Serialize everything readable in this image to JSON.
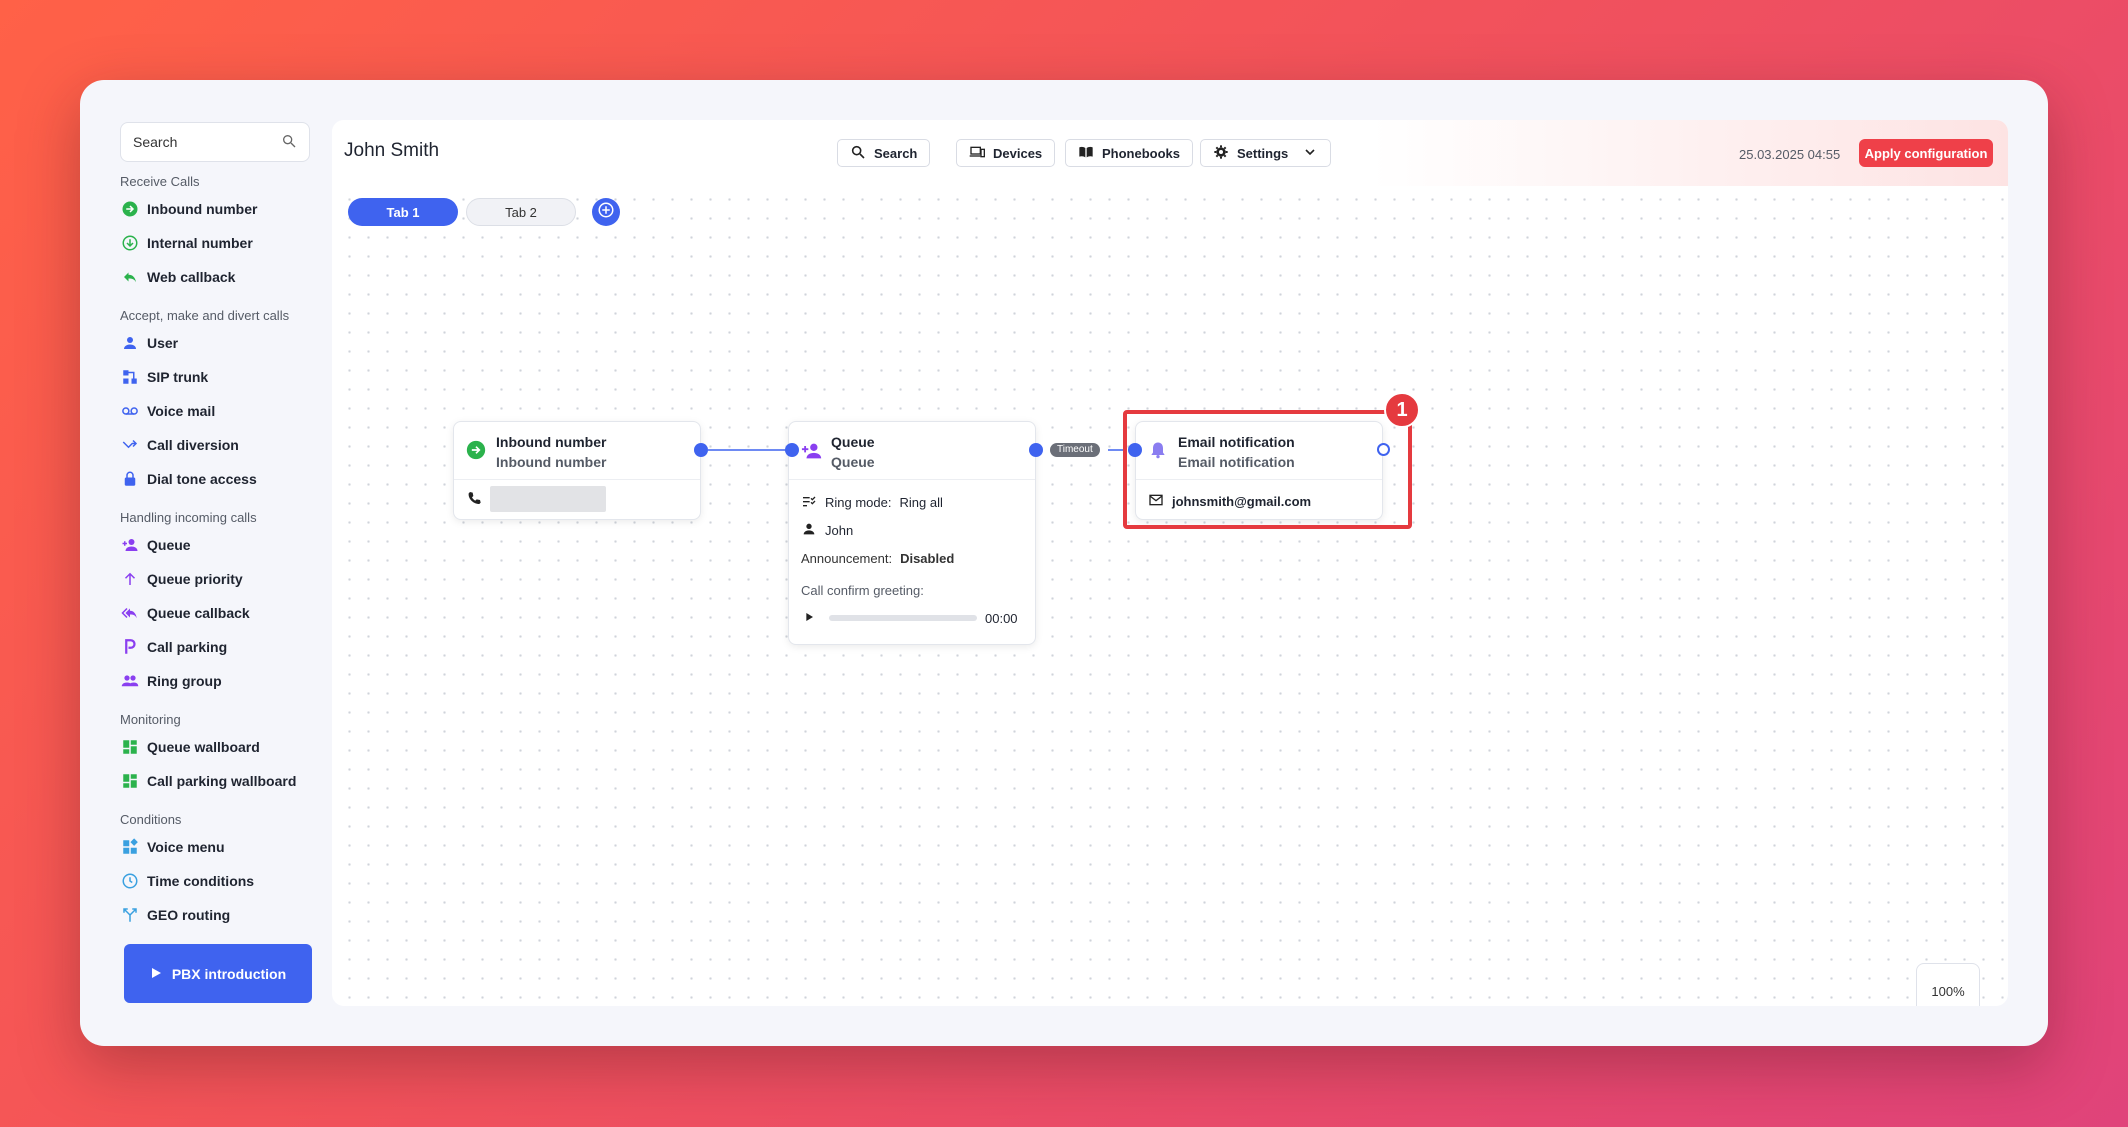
{
  "sidebar": {
    "search_placeholder": "Search",
    "groups": [
      {
        "title": "Receive Calls",
        "items": [
          {
            "label": "Inbound number",
            "icon": "arrow-circle-icon",
            "color": "#2bb24c"
          },
          {
            "label": "Internal number",
            "icon": "download-circle-icon",
            "color": "#2bb24c"
          },
          {
            "label": "Web callback",
            "icon": "reply-icon",
            "color": "#2bb24c"
          }
        ]
      },
      {
        "title": "Accept, make and divert calls",
        "items": [
          {
            "label": "User",
            "icon": "user-icon",
            "color": "#3f63ef"
          },
          {
            "label": "SIP trunk",
            "icon": "sip-trunk-icon",
            "color": "#3f63ef"
          },
          {
            "label": "Voice mail",
            "icon": "voicemail-icon",
            "color": "#3f63ef"
          },
          {
            "label": "Call diversion",
            "icon": "call-diversion-icon",
            "color": "#3f63ef"
          },
          {
            "label": "Dial tone access",
            "icon": "lock-icon",
            "color": "#3f63ef"
          }
        ]
      },
      {
        "title": "Handling incoming calls",
        "items": [
          {
            "label": "Queue",
            "icon": "person-add-icon",
            "color": "#8a3ff0"
          },
          {
            "label": "Queue priority",
            "icon": "arrow-up-icon",
            "color": "#8a3ff0"
          },
          {
            "label": "Queue callback",
            "icon": "reply-all-icon",
            "color": "#8a3ff0"
          },
          {
            "label": "Call parking",
            "icon": "parking-icon",
            "color": "#8a3ff0"
          },
          {
            "label": "Ring group",
            "icon": "group-icon",
            "color": "#8a3ff0"
          }
        ]
      },
      {
        "title": "Monitoring",
        "items": [
          {
            "label": "Queue wallboard",
            "icon": "dashboard-icon",
            "color": "#2bb24c"
          },
          {
            "label": "Call parking wallboard",
            "icon": "dashboard-icon",
            "color": "#2bb24c"
          }
        ]
      },
      {
        "title": "Conditions",
        "items": [
          {
            "label": "Voice menu",
            "icon": "widgets-icon",
            "color": "#3aa0e0"
          },
          {
            "label": "Time conditions",
            "icon": "clock-icon",
            "color": "#3aa0e0"
          },
          {
            "label": "GEO routing",
            "icon": "fork-icon",
            "color": "#3aa0e0"
          }
        ]
      }
    ],
    "pbx_button": "PBX introduction"
  },
  "header": {
    "title": "John Smith",
    "search_label": "Search",
    "devices_label": "Devices",
    "phonebooks_label": "Phonebooks",
    "settings_label": "Settings",
    "timestamp": "25.03.2025 04:55",
    "apply_label": "Apply configuration"
  },
  "tabs": [
    {
      "label": "Tab 1",
      "active": true
    },
    {
      "label": "Tab 2",
      "active": false
    }
  ],
  "nodes": {
    "inbound": {
      "title": "Inbound number",
      "subtitle": "Inbound number"
    },
    "queue": {
      "title": "Queue",
      "subtitle": "Queue",
      "ring_mode_label": "Ring mode:",
      "ring_mode_value": "Ring all",
      "user": "John",
      "announcement_label": "Announcement:",
      "announcement_value": "Disabled",
      "greeting_label": "Call confirm greeting:",
      "greeting_time": "00:00"
    },
    "email": {
      "title": "Email notification",
      "subtitle": "Email notification",
      "email": "johnsmith@gmail.com"
    }
  },
  "edge_label": "Timeout",
  "highlight_badge": "1",
  "zoom": "100%",
  "colors": {
    "accent": "#3f63ef",
    "apply": "#ef4049",
    "highlight": "#e53a3f"
  }
}
